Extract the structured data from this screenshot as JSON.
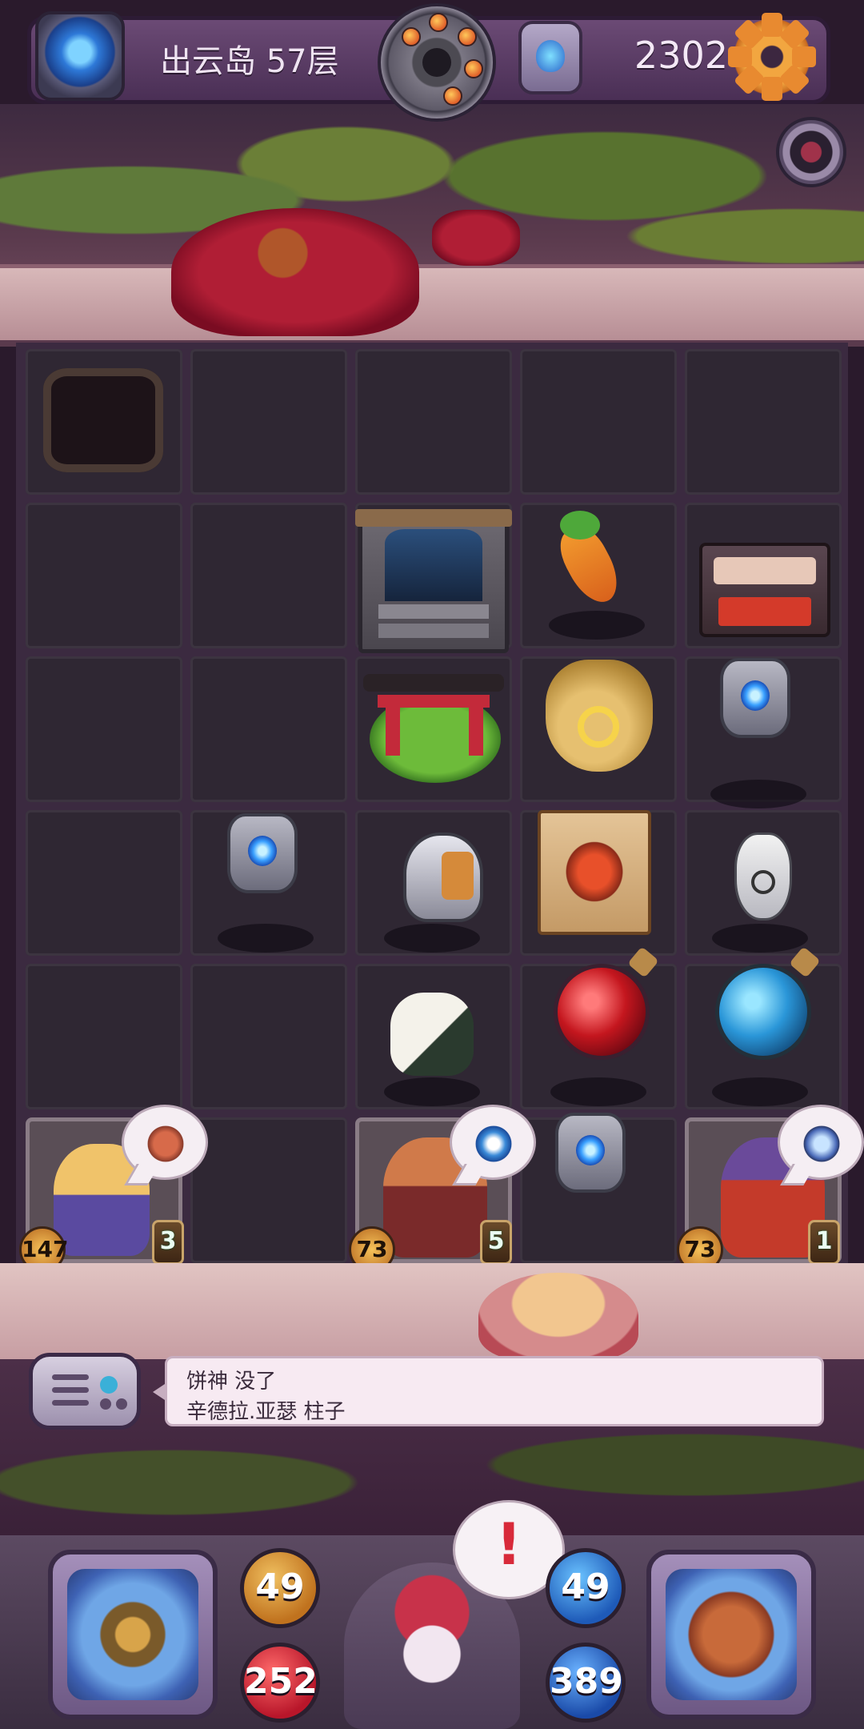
{
  "header": {
    "floor": "出云岛 57层",
    "gold": "2302"
  },
  "board": {
    "heroes": [
      {
        "name": "wolf-warrior",
        "attack": "147",
        "level": "3"
      },
      {
        "name": "monkey-swordsman",
        "attack": "73",
        "level": "5"
      },
      {
        "name": "bird-knight",
        "attack": "73",
        "level": "1"
      }
    ]
  },
  "dialog": {
    "line1": "饼神 没了",
    "line2": "辛德拉.亚瑟 柱子"
  },
  "stats": {
    "attack_left": "49",
    "hp_left": "252",
    "attack_right": "49",
    "hp_right": "389"
  },
  "alert": "!",
  "colors": {
    "accent": "#f2a640",
    "hp": "#d1293d",
    "mana": "#2f7ed8"
  }
}
